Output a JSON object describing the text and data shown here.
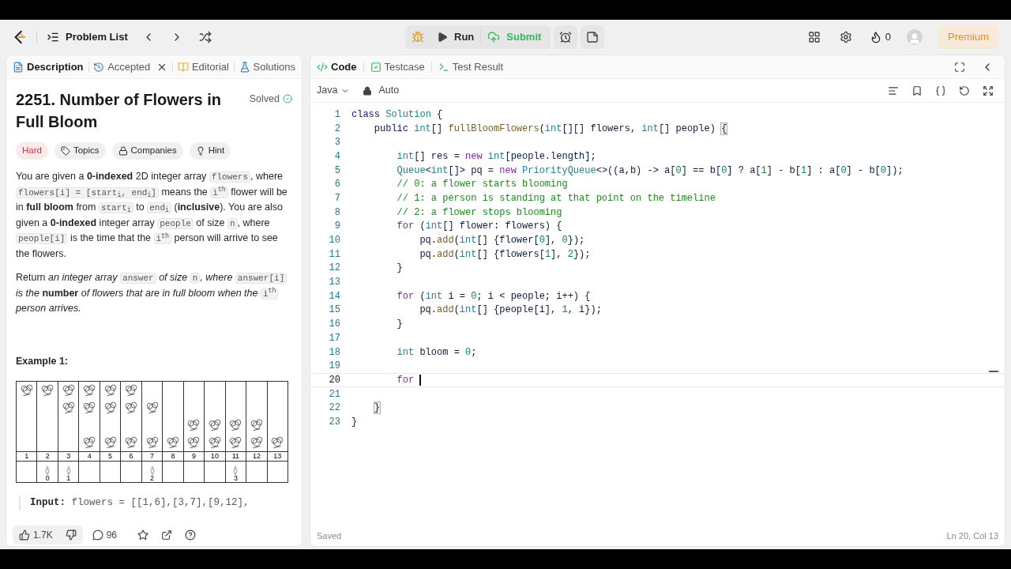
{
  "nav": {
    "problem_list": "Problem List",
    "run": "Run",
    "submit": "Submit",
    "streak": "0",
    "premium": "Premium"
  },
  "left_tabs": [
    {
      "label": "Description",
      "selected": true,
      "closable": false
    },
    {
      "label": "Accepted",
      "selected": false,
      "closable": true
    },
    {
      "label": "Editorial",
      "selected": false,
      "closable": false
    },
    {
      "label": "Solutions",
      "selected": false,
      "closable": false
    }
  ],
  "problem": {
    "title": "2251. Number of Flowers in Full Bloom",
    "status": "Solved",
    "tags": [
      {
        "kind": "difficulty",
        "label": "Hard"
      },
      {
        "kind": "topics",
        "label": "Topics"
      },
      {
        "kind": "companies",
        "label": "Companies"
      },
      {
        "kind": "hint",
        "label": "Hint"
      }
    ],
    "paragraphs": [
      [
        {
          "kind": "text",
          "text": "You are given a **0-indexed** 2D integer array "
        },
        {
          "kind": "code",
          "text": "flowers"
        },
        {
          "kind": "text",
          "text": ", where "
        },
        {
          "kind": "code",
          "text": "flowers[i] = [start$_{i}$, end$_{i}$]"
        },
        {
          "kind": "text",
          "text": " means the "
        },
        {
          "kind": "code",
          "text": "i$^{th}$"
        },
        {
          "kind": "text",
          "text": " flower will be in **full bloom** from "
        },
        {
          "kind": "code",
          "text": "start$_{i}$"
        },
        {
          "kind": "text",
          "text": " to "
        },
        {
          "kind": "code",
          "text": "end$_{i}$"
        },
        {
          "kind": "text",
          "text": " (**inclusive**). You are also given a **0-indexed** integer array "
        },
        {
          "kind": "code",
          "text": "people"
        },
        {
          "kind": "text",
          "text": " of size "
        },
        {
          "kind": "code",
          "text": "n"
        },
        {
          "kind": "text",
          "text": ", where "
        },
        {
          "kind": "code",
          "text": "people[i]"
        },
        {
          "kind": "text",
          "text": " is the time that the "
        },
        {
          "kind": "code",
          "text": "i$^{th}$"
        },
        {
          "kind": "text",
          "text": " person will arrive to see the flowers."
        }
      ],
      [
        {
          "kind": "text",
          "text": "Return *an integer array* "
        },
        {
          "kind": "code",
          "text": "answer"
        },
        {
          "kind": "text",
          "text": " *of size* "
        },
        {
          "kind": "code",
          "text": "n"
        },
        {
          "kind": "text",
          "text": "*, where* "
        },
        {
          "kind": "code",
          "text": "answer[i]"
        },
        {
          "kind": "text",
          "text": " *is the* **number** *of flowers that are in full bloom when the* "
        },
        {
          "kind": "code",
          "text": "i$^{th}$"
        },
        {
          "kind": "text",
          "text": " *person arrives.*"
        }
      ]
    ],
    "example_title": "Example 1:",
    "diagram": [
      {
        "day": "1",
        "flowers": [
          true,
          false,
          false,
          false
        ]
      },
      {
        "day": "2",
        "flowers": [
          true,
          false,
          false,
          false
        ],
        "person": "0"
      },
      {
        "day": "3",
        "flowers": [
          true,
          true,
          false,
          false
        ],
        "person": "1"
      },
      {
        "day": "4",
        "flowers": [
          true,
          true,
          false,
          true
        ]
      },
      {
        "day": "5",
        "flowers": [
          true,
          true,
          false,
          true
        ]
      },
      {
        "day": "6",
        "flowers": [
          true,
          true,
          false,
          true
        ]
      },
      {
        "day": "7",
        "flowers": [
          false,
          true,
          false,
          true
        ],
        "person": "2"
      },
      {
        "day": "8",
        "flowers": [
          false,
          false,
          false,
          true
        ]
      },
      {
        "day": "9",
        "flowers": [
          false,
          false,
          true,
          true
        ]
      },
      {
        "day": "10",
        "flowers": [
          false,
          false,
          true,
          true
        ]
      },
      {
        "day": "11",
        "flowers": [
          false,
          false,
          true,
          true
        ],
        "person": "3"
      },
      {
        "day": "12",
        "flowers": [
          false,
          false,
          true,
          true
        ]
      },
      {
        "day": "13",
        "flowers": [
          false,
          false,
          false,
          true
        ]
      }
    ],
    "input_label": "Input:",
    "input_text": "flowers = [[1,6],[3,7],[9,12],"
  },
  "footer": {
    "likes": "1.7K",
    "comments": "96"
  },
  "right_tabs": [
    {
      "label": "Code",
      "selected": true
    },
    {
      "label": "Testcase",
      "selected": false
    },
    {
      "label": "Test Result",
      "selected": false
    }
  ],
  "editor": {
    "language": "Java",
    "mode": "Auto",
    "status": "Saved",
    "position": "Ln 20, Col 13",
    "lines": [
      {
        "number": "1",
        "current": false,
        "tokens": [
          {
            "kind": "decl",
            "text": "class "
          },
          {
            "kind": "type",
            "text": "Solution"
          },
          {
            "kind": "plain",
            "text": " {"
          }
        ]
      },
      {
        "number": "2",
        "current": false,
        "tokens": [
          {
            "kind": "decl",
            "text": "    public "
          },
          {
            "kind": "type",
            "text": "int"
          },
          {
            "kind": "plain",
            "text": "[] "
          },
          {
            "kind": "fn",
            "text": "fullBloomFlowers"
          },
          {
            "kind": "plain",
            "text": "("
          },
          {
            "kind": "type",
            "text": "int"
          },
          {
            "kind": "plain",
            "text": "[][] flowers, "
          },
          {
            "kind": "type",
            "text": "int"
          },
          {
            "kind": "plain",
            "text": "[] people) "
          },
          {
            "kind": "match",
            "text": "{"
          }
        ]
      },
      {
        "number": "3",
        "current": false
      },
      {
        "number": "4",
        "current": false,
        "tokens": [
          {
            "kind": "type",
            "text": "        int"
          },
          {
            "kind": "plain",
            "text": "[] res = "
          },
          {
            "kind": "kw",
            "text": "new "
          },
          {
            "kind": "type",
            "text": "int"
          },
          {
            "kind": "plain",
            "text": "[people.length];"
          }
        ]
      },
      {
        "number": "5",
        "current": false,
        "tokens": [
          {
            "kind": "type",
            "text": "        Queue"
          },
          {
            "kind": "plain",
            "text": "<"
          },
          {
            "kind": "type",
            "text": "int"
          },
          {
            "kind": "plain",
            "text": "[]> pq = "
          },
          {
            "kind": "kw",
            "text": "new "
          },
          {
            "kind": "type",
            "text": "PriorityQueue"
          },
          {
            "kind": "plain",
            "text": "<>((a,b) -> a["
          },
          {
            "kind": "num",
            "text": "0"
          },
          {
            "kind": "plain",
            "text": "] == b["
          },
          {
            "kind": "num",
            "text": "0"
          },
          {
            "kind": "plain",
            "text": "] ? a["
          },
          {
            "kind": "num",
            "text": "1"
          },
          {
            "kind": "plain",
            "text": "] - b["
          },
          {
            "kind": "num",
            "text": "1"
          },
          {
            "kind": "plain",
            "text": "] : a["
          },
          {
            "kind": "num",
            "text": "0"
          },
          {
            "kind": "plain",
            "text": "] - b["
          },
          {
            "kind": "num",
            "text": "0"
          },
          {
            "kind": "plain",
            "text": "]);"
          }
        ]
      },
      {
        "number": "6",
        "current": false,
        "tokens": [
          {
            "kind": "comment",
            "text": "        // 0: a flower starts blooming"
          }
        ]
      },
      {
        "number": "7",
        "current": false,
        "tokens": [
          {
            "kind": "comment",
            "text": "        // 1: a person is standing at that point on the timeline"
          }
        ]
      },
      {
        "number": "8",
        "current": false,
        "tokens": [
          {
            "kind": "comment",
            "text": "        // 2: a flower stops blooming"
          }
        ]
      },
      {
        "number": "9",
        "current": false,
        "tokens": [
          {
            "kind": "kw",
            "text": "        for "
          },
          {
            "kind": "plain",
            "text": "("
          },
          {
            "kind": "type",
            "text": "int"
          },
          {
            "kind": "plain",
            "text": "[] flower: flowers) {"
          }
        ]
      },
      {
        "number": "10",
        "current": false,
        "tokens": [
          {
            "kind": "plain",
            "text": "            pq."
          },
          {
            "kind": "fn",
            "text": "add"
          },
          {
            "kind": "plain",
            "text": "("
          },
          {
            "kind": "type",
            "text": "int"
          },
          {
            "kind": "plain",
            "text": "[] {flower["
          },
          {
            "kind": "num",
            "text": "0"
          },
          {
            "kind": "plain",
            "text": "], "
          },
          {
            "kind": "num",
            "text": "0"
          },
          {
            "kind": "plain",
            "text": "});"
          }
        ]
      },
      {
        "number": "11",
        "current": false,
        "tokens": [
          {
            "kind": "plain",
            "text": "            pq."
          },
          {
            "kind": "fn",
            "text": "add"
          },
          {
            "kind": "plain",
            "text": "("
          },
          {
            "kind": "type",
            "text": "int"
          },
          {
            "kind": "plain",
            "text": "[] {flowers["
          },
          {
            "kind": "num",
            "text": "1"
          },
          {
            "kind": "plain",
            "text": "], "
          },
          {
            "kind": "num",
            "text": "2"
          },
          {
            "kind": "plain",
            "text": "});"
          }
        ]
      },
      {
        "number": "12",
        "current": false,
        "tokens": [
          {
            "kind": "plain",
            "text": "        }"
          }
        ]
      },
      {
        "number": "13",
        "current": false
      },
      {
        "number": "14",
        "current": false,
        "tokens": [
          {
            "kind": "kw",
            "text": "        for "
          },
          {
            "kind": "plain",
            "text": "("
          },
          {
            "kind": "type",
            "text": "int"
          },
          {
            "kind": "plain",
            "text": " i = "
          },
          {
            "kind": "num",
            "text": "0"
          },
          {
            "kind": "plain",
            "text": "; i < people; i++) {"
          }
        ]
      },
      {
        "number": "15",
        "current": false,
        "tokens": [
          {
            "kind": "plain",
            "text": "            pq."
          },
          {
            "kind": "fn",
            "text": "add"
          },
          {
            "kind": "plain",
            "text": "("
          },
          {
            "kind": "type",
            "text": "int"
          },
          {
            "kind": "plain",
            "text": "[] {people[i], "
          },
          {
            "kind": "num",
            "text": "1"
          },
          {
            "kind": "plain",
            "text": ", i});"
          }
        ]
      },
      {
        "number": "16",
        "current": false,
        "tokens": [
          {
            "kind": "plain",
            "text": "        }"
          }
        ]
      },
      {
        "number": "17",
        "current": false
      },
      {
        "number": "18",
        "current": false,
        "tokens": [
          {
            "kind": "type",
            "text": "        int"
          },
          {
            "kind": "plain",
            "text": " bloom = "
          },
          {
            "kind": "num",
            "text": "0"
          },
          {
            "kind": "plain",
            "text": ";"
          }
        ]
      },
      {
        "number": "19",
        "current": false
      },
      {
        "number": "20",
        "current": true,
        "tokens": [
          {
            "kind": "kw",
            "text": "        for "
          }
        ]
      },
      {
        "number": "21",
        "current": false
      },
      {
        "number": "22",
        "current": false,
        "tokens": [
          {
            "kind": "match",
            "text": "    }"
          }
        ]
      },
      {
        "number": "23",
        "current": false,
        "tokens": [
          {
            "kind": "plain",
            "text": "}"
          }
        ]
      }
    ]
  }
}
